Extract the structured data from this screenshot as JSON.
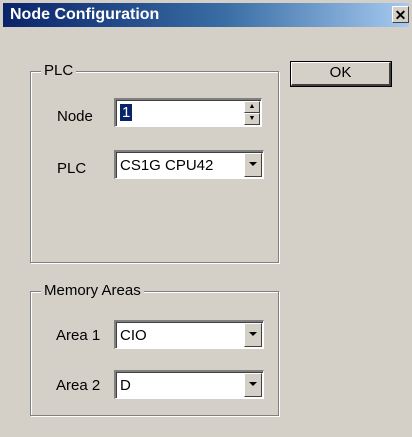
{
  "window": {
    "title": "Node Configuration",
    "close_glyph": "✕"
  },
  "plc_group": {
    "legend": "PLC",
    "node_label": "Node",
    "node_value": "1",
    "plc_label": "PLC",
    "plc_value": "CS1G CPU42"
  },
  "memory_group": {
    "legend": "Memory Areas",
    "area1_label": "Area 1",
    "area1_value": "CIO",
    "area2_label": "Area 2",
    "area2_value": "D"
  },
  "buttons": {
    "ok_label": "OK"
  }
}
